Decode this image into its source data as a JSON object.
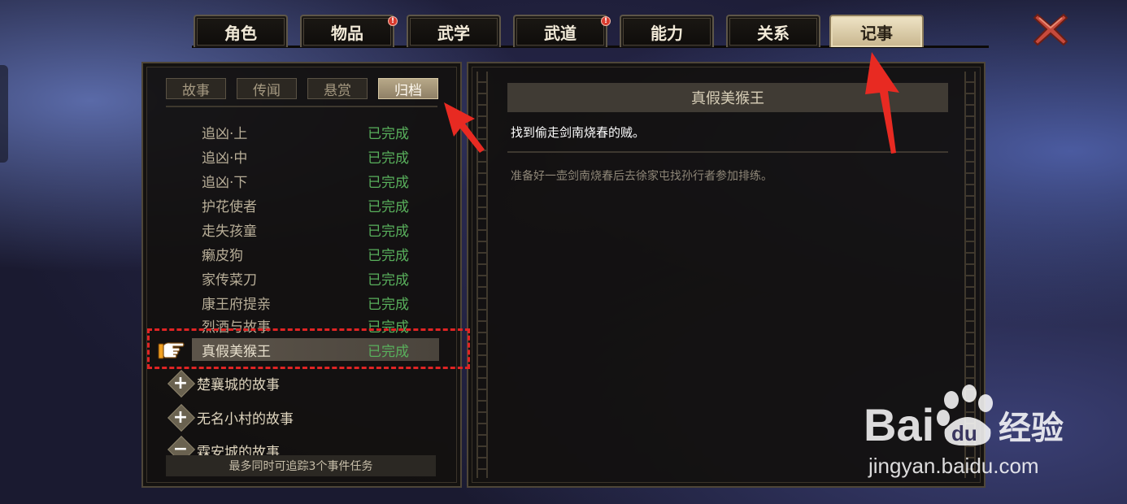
{
  "top_tabs": [
    {
      "label": "角色",
      "badge": null,
      "active": false
    },
    {
      "label": "物品",
      "badge": "!",
      "active": false
    },
    {
      "label": "武学",
      "badge": null,
      "active": false
    },
    {
      "label": "武道",
      "badge": "!",
      "active": false
    },
    {
      "label": "能力",
      "badge": null,
      "active": false
    },
    {
      "label": "关系",
      "badge": null,
      "active": false
    },
    {
      "label": "记事",
      "badge": null,
      "active": true
    }
  ],
  "sub_tabs": [
    {
      "label": "故事",
      "active": false
    },
    {
      "label": "传闻",
      "active": false
    },
    {
      "label": "悬赏",
      "active": false
    },
    {
      "label": "归档",
      "active": true
    }
  ],
  "quests": [
    {
      "name": "追凶·上",
      "status": "已完成"
    },
    {
      "name": "追凶·中",
      "status": "已完成"
    },
    {
      "name": "追凶·下",
      "status": "已完成"
    },
    {
      "name": "护花使者",
      "status": "已完成"
    },
    {
      "name": "走失孩童",
      "status": "已完成"
    },
    {
      "name": "癞皮狗",
      "status": "已完成"
    },
    {
      "name": "家传菜刀",
      "status": "已完成"
    },
    {
      "name": "康王府提亲",
      "status": "已完成"
    },
    {
      "name": "烈酒与故事",
      "status": "已完成"
    },
    {
      "name": "真假美猴王",
      "status": "已完成",
      "selected": true
    }
  ],
  "groups": [
    {
      "symbol": "+",
      "label": "楚襄城的故事"
    },
    {
      "symbol": "+",
      "label": "无名小村的故事"
    },
    {
      "symbol": "−",
      "label": "霖安城的故事"
    }
  ],
  "track_note": "最多同时可追踪3个事件任务",
  "detail": {
    "title": "真假美猴王",
    "goal": "找到偷走剑南烧春的贼。",
    "description": "准备好一壶剑南烧春后去徐家屯找孙行者参加排练。"
  },
  "watermark": {
    "brand": "Bai",
    "brand2": "du",
    "cn": "经验",
    "url": "jingyan.baidu.com"
  },
  "colors": {
    "complete": "#59b05c",
    "annotation": "#e02424"
  }
}
